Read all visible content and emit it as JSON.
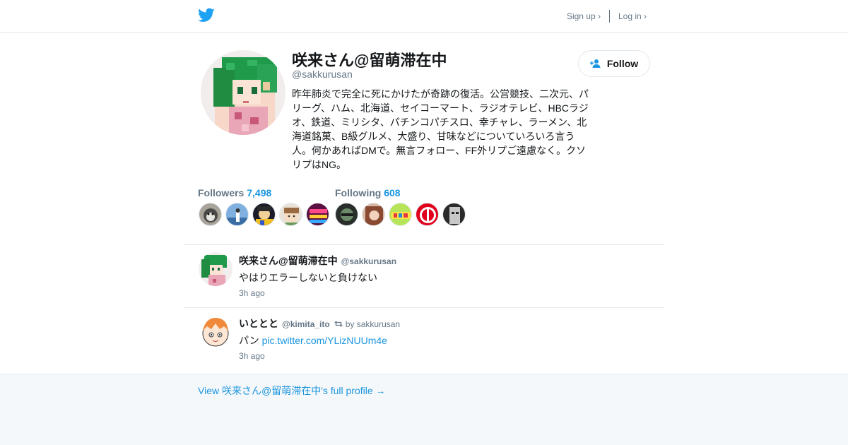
{
  "nav": {
    "signup": "Sign up ›",
    "login": "Log in ›"
  },
  "profile": {
    "name": "咲来さん@留萌滞在中",
    "handle": "@sakkurusan",
    "bio": "昨年肺炎で完全に死にかけたが奇跡の復活。公営競技、二次元、パリーグ、ハム、北海道、セイコーマート、ラジオテレビ、HBCラジオ、鉄道、ミリシタ、パチンコパチスロ、幸チャレ、ラーメン、北海道銘菓、B級グルメ、大盛り、甘味などについていろいろ言う人。何かあればDMで。無言フォロー、FF外リプご遠慮なく。クソリプはNG。",
    "follow_label": "Follow"
  },
  "stats": {
    "followers_label": "Followers",
    "followers_count": "7,498",
    "following_label": "Following",
    "following_count": "608"
  },
  "tweets": [
    {
      "name": "咲来さん@留萌滞在中",
      "handle": "@sakkurusan",
      "text": "やはりエラーしないと負けない",
      "time": "3h ago"
    },
    {
      "name": "いととと",
      "handle": "@kimita_ito",
      "retweet_by": "by sakkurusan",
      "text_prefix": "パン ",
      "link": "pic.twitter.com/YLizNUUm4e",
      "time": "3h ago"
    }
  ],
  "footer": {
    "link": "View 咲来さん@留萌滞在中's full profile →"
  },
  "icons": {
    "logo": "twitter-bird-icon",
    "follow": "add-user-icon",
    "retweet": "retweet-icon"
  },
  "colors": {
    "accent": "#1b95e0",
    "logo": "#1da1f2",
    "muted": "#657786",
    "footer_bg": "#f5f8fa"
  }
}
